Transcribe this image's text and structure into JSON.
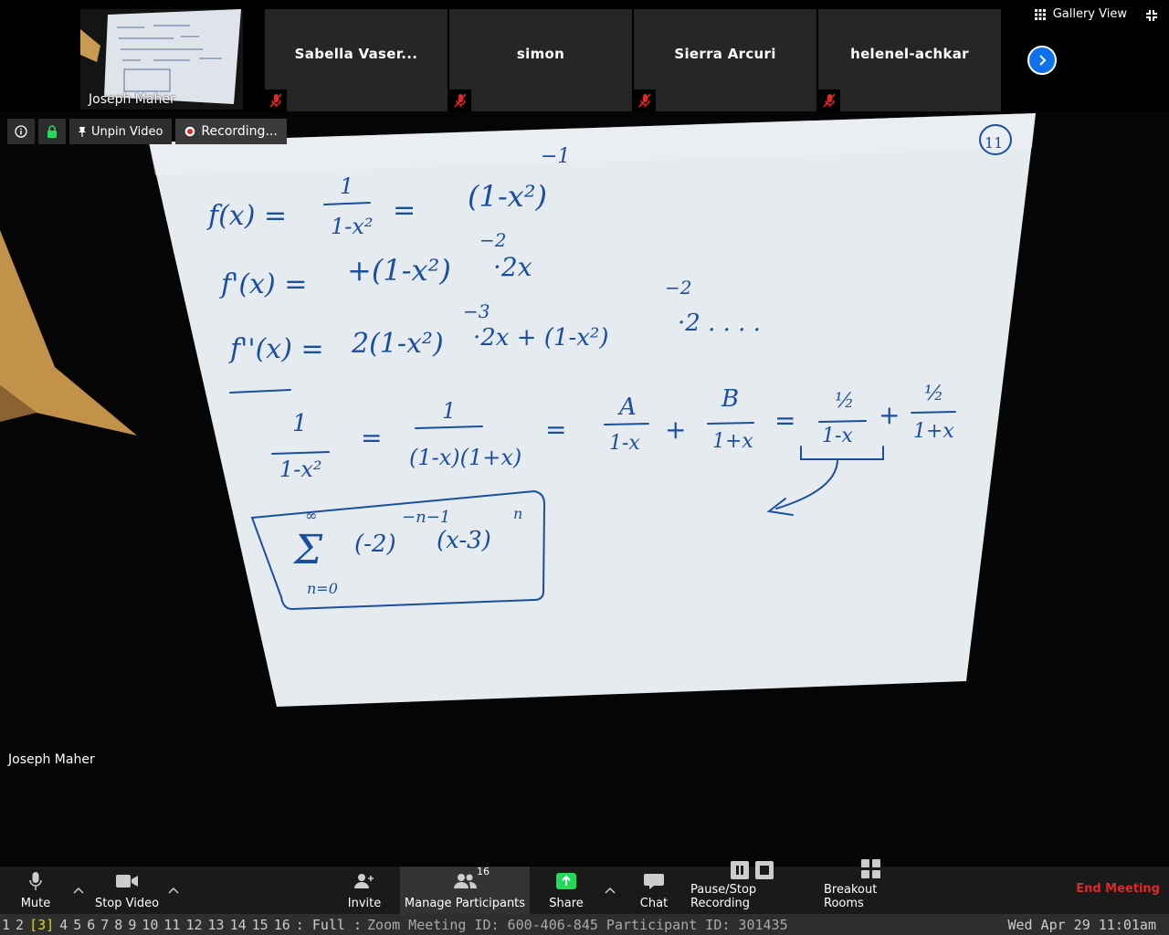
{
  "self_view": {
    "name": "Joseph Maher"
  },
  "participants": [
    {
      "name": "Sabella Vaser..."
    },
    {
      "name": "simon"
    },
    {
      "name": "Sierra Arcuri"
    },
    {
      "name": "helenel-achkar"
    }
  ],
  "view_controls": {
    "gallery_label": "Gallery View"
  },
  "video_toolbar": {
    "unpin_label": "Unpin Video",
    "recording_label": "Recording..."
  },
  "main_video": {
    "speaker_name": "Joseph Maher",
    "whiteboard": {
      "page_number": "11",
      "lines": [
        "f(x) = 1/(1-x²) = (1-x²)^-1",
        "f'(x) = +(1-x²)^-2 · 2x",
        "f''(x) = 2(1-x²)^-3 · 2x + (1-x²)^-2 · 2 ...",
        "1/(1-x²) = 1/((1-x)(1+x)) = A/(1-x) + B/(1+x) = ½/(1-x) + ½/(1+x)",
        "Σ n=0 to ∞ (-2)^(-n-1) (x-3)^n"
      ]
    }
  },
  "toolbar": {
    "mute": "Mute",
    "stop_video": "Stop Video",
    "invite": "Invite",
    "manage_participants": "Manage Participants",
    "participant_count": "16",
    "share": "Share",
    "chat": "Chat",
    "pause_stop_recording": "Pause/Stop Recording",
    "breakout_rooms": "Breakout Rooms",
    "end_meeting": "End Meeting"
  },
  "statusbar": {
    "workspaces_before": [
      "1",
      "2"
    ],
    "workspace_current": "[3]",
    "workspaces_after": [
      "4",
      "5",
      "6",
      "7",
      "8",
      "9",
      "10",
      "11",
      "12",
      "13",
      "14",
      "15",
      "16"
    ],
    "mode": ": Full :",
    "window_title": "Zoom Meeting ID: 600-406-845 Participant ID: 301435",
    "clock": "Wed Apr 29 11:01am"
  },
  "colors": {
    "accent_blue": "#0e71eb",
    "end_red": "#e02828",
    "share_green": "#23d959",
    "ink": "#1a4fa0"
  }
}
